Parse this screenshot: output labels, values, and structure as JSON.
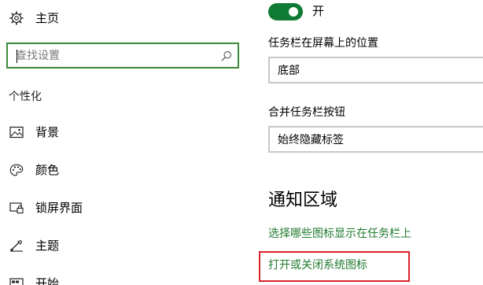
{
  "sidebar": {
    "home_label": "主页",
    "search_placeholder": "查找设置",
    "search_value": "",
    "section_label": "个性化",
    "items": [
      {
        "label": "背景",
        "icon": "image-icon"
      },
      {
        "label": "颜色",
        "icon": "palette-icon"
      },
      {
        "label": "锁屏界面",
        "icon": "lock-screen-icon"
      },
      {
        "label": "主题",
        "icon": "theme-brush-icon"
      },
      {
        "label": "开始",
        "icon": "start-icon"
      }
    ]
  },
  "main": {
    "toggle": {
      "state": "on",
      "label": "开"
    },
    "taskbar_position": {
      "label": "任务栏在屏幕上的位置",
      "value": "底部"
    },
    "combine_buttons": {
      "label": "合并任务栏按钮",
      "value": "始终隐藏标签"
    },
    "notification_area": {
      "title": "通知区域",
      "links": [
        "选择哪些图标显示在任务栏上",
        "打开或关闭系统图标"
      ]
    }
  },
  "colors": {
    "accent_green": "#0e7a33",
    "link_green": "#1f7a2e",
    "search_border_green": "#3b8a3b",
    "highlight_red": "#d9232a"
  }
}
